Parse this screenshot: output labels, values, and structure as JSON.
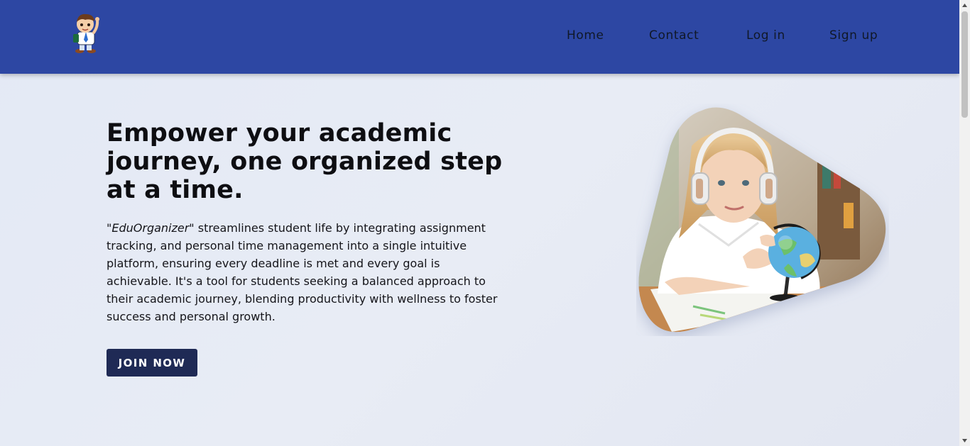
{
  "header": {
    "bg_color": "#2d47a3",
    "logo_icon": "student-mascot-icon",
    "nav": [
      {
        "label": "Home"
      },
      {
        "label": "Contact"
      },
      {
        "label": "Log in"
      },
      {
        "label": "Sign up"
      }
    ]
  },
  "hero": {
    "title": "Empower your academic journey, one organized step at a time.",
    "brand": "\"EduOrganizer\"",
    "description": " streamlines student life by integrating assignment tracking, and personal time management into a single intuitive platform, ensuring every deadline is met and every goal is achievable. It's a tool for students seeking a balanced approach to their academic journey, blending productivity with wellness to foster success and personal growth.",
    "cta_label": "JOIN NOW",
    "cta_color": "#1f2a55",
    "image_icon": "girl-with-globe-photo"
  }
}
